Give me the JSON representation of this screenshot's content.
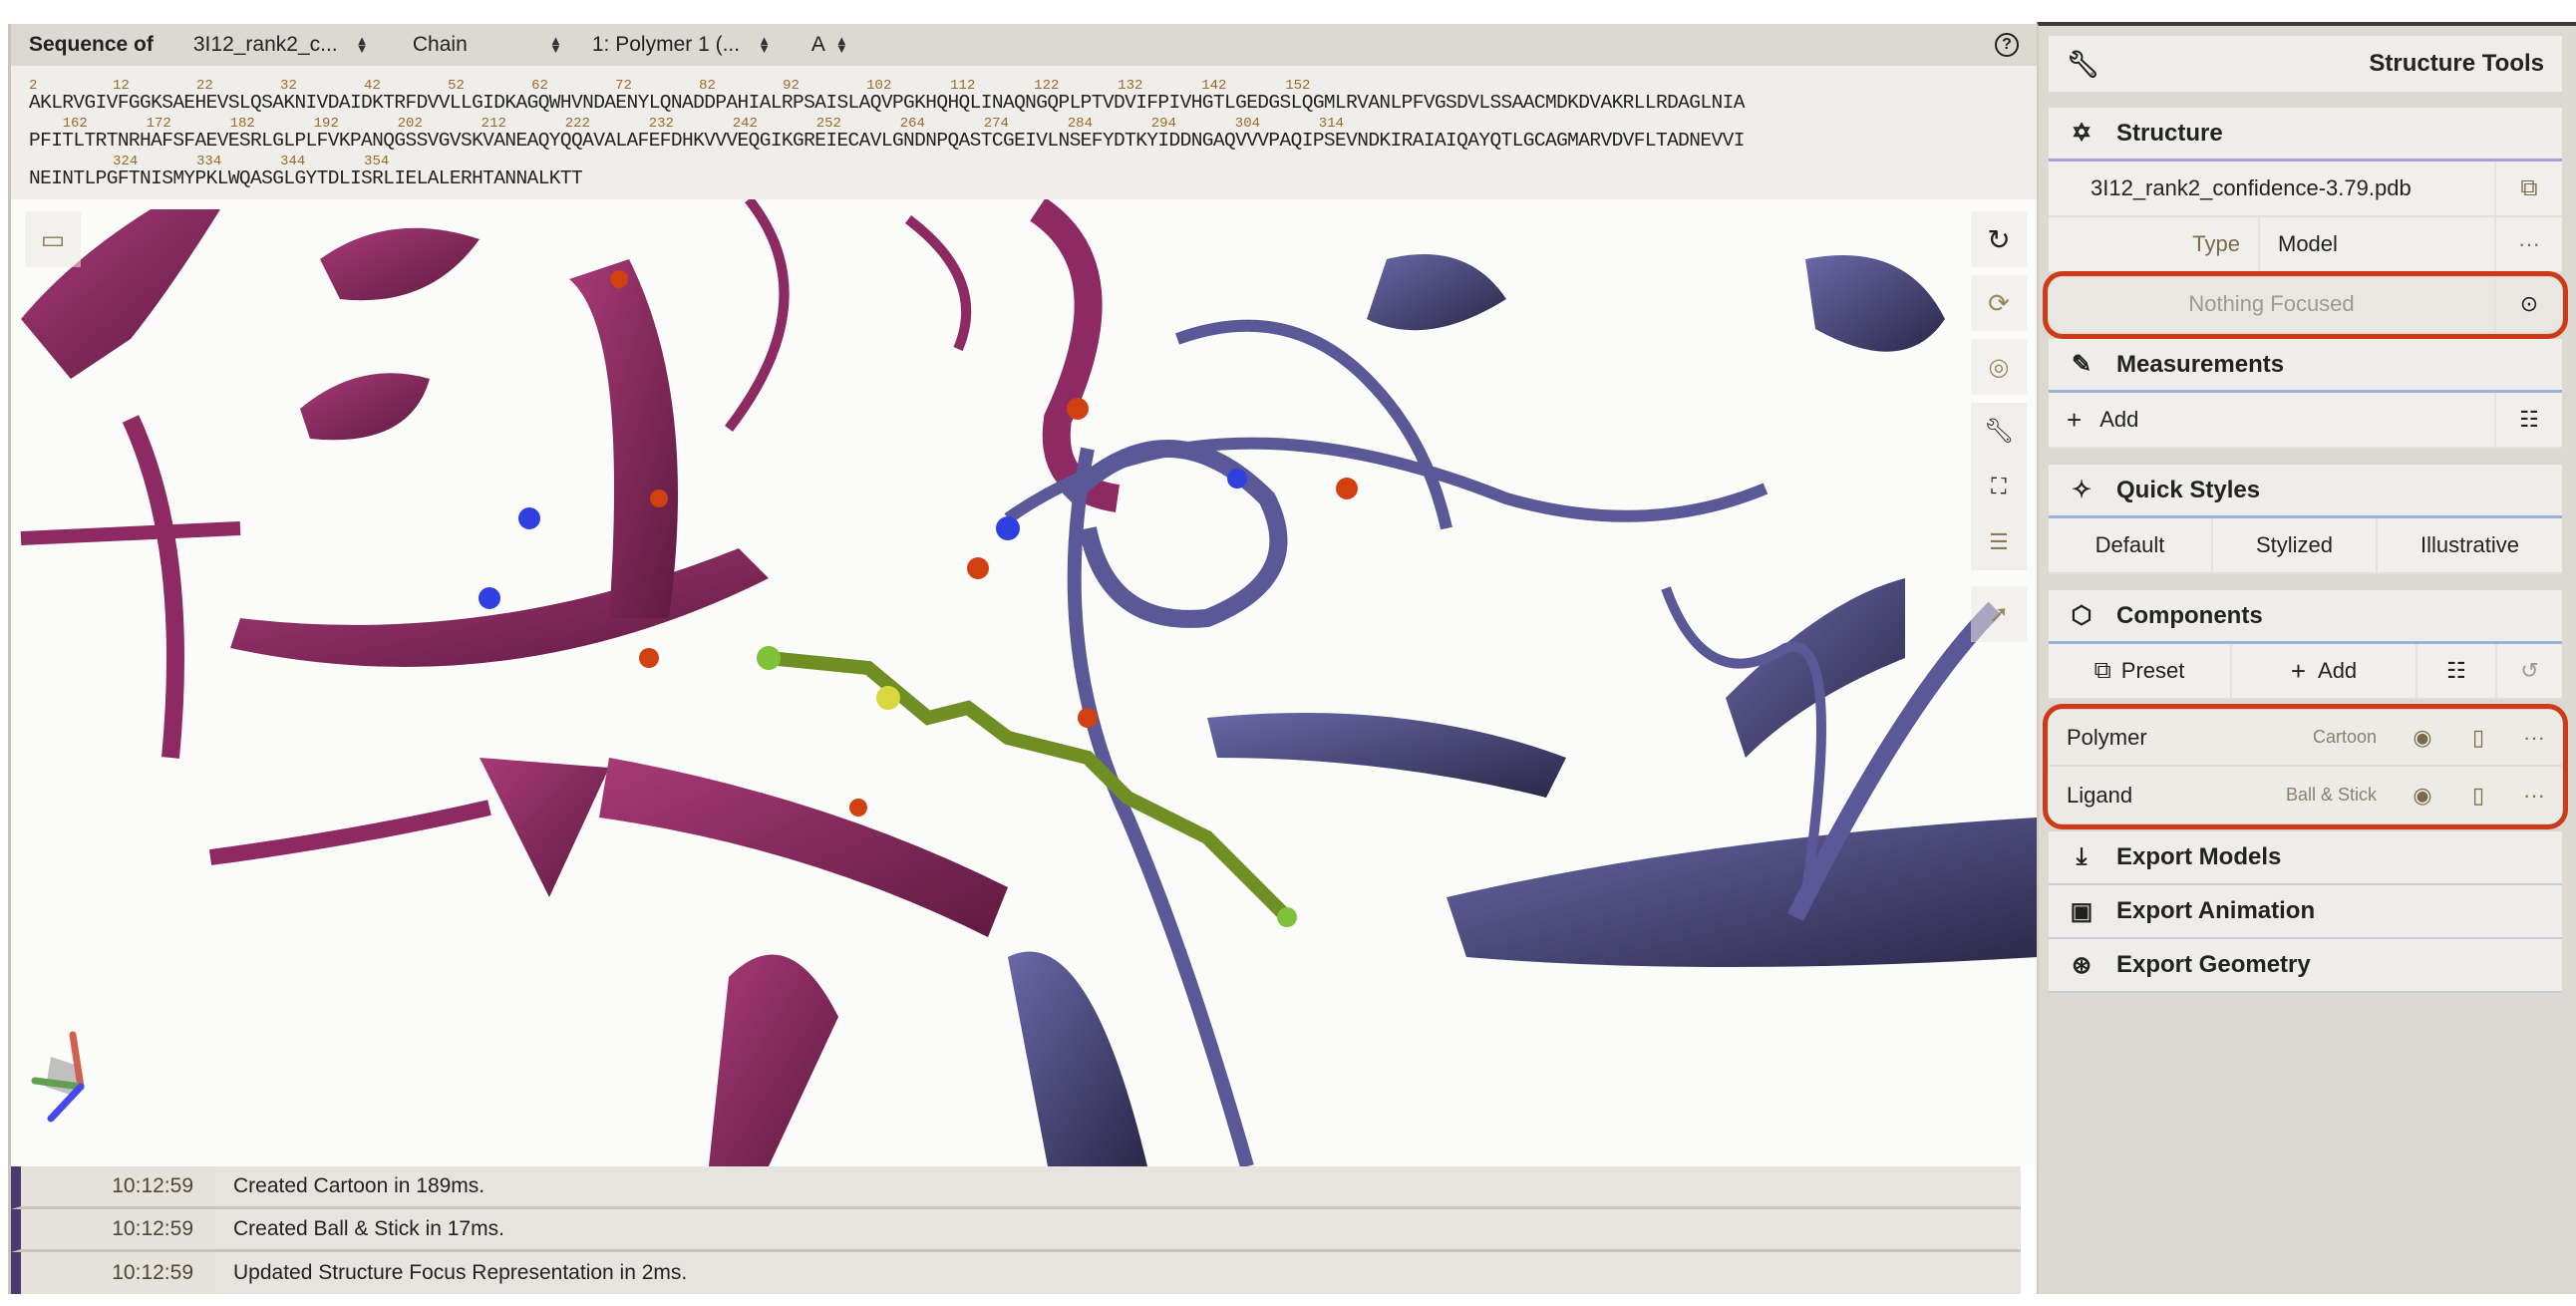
{
  "sequence_panel": {
    "title": "Sequence of",
    "selectors": [
      {
        "value": "3I12_rank2_c..."
      },
      {
        "value": "Chain"
      },
      {
        "value": "1: Polymer 1 (..."
      },
      {
        "value": "A"
      }
    ],
    "help_icon": "question-circle-icon",
    "lines": [
      {
        "numbers": "2         12        22        32        42        52        62        72        82        92        102       112       122       132       142       152",
        "residues": "AKLRVGIVFGGKSAEHEVSLQSAKNIVDAIDKTRFDVVLLGIDKAGQWHVNDAENYLQNADDPAHIALRPSAISLAQVPGKHQHQLINAQNGQPLPTVDVIFPIVHGTLGEDGSLQGMLRVANLPFVGSDVLSSAACMDKDVAKRLLRDAGLNIA"
      },
      {
        "numbers": "    162       172       182       192       202       212       222       232       242       252       264       274       284       294       304       314",
        "residues": "PFITLTRTNRHAFSFAEVESRLGLPLFVKPANQGSSVGVSKVANEAQYQQAVALAFEFDHKVVVEQGIKGREIECAVLGNDNPQASTCGEIVLNSEFYDTKYIDDNGAQVVVPAQIPSEVNDKIRAIAIQAYQTLGCAGMARVDVFLTADNEVVI"
      },
      {
        "numbers": "          324       334       344       354",
        "residues": "NEINTLPGFTNISMYPKLWQASGLGYTDLISRLIELALERHTANNALKTT"
      }
    ]
  },
  "viewport": {
    "left_button": "animation-icon",
    "toolbar": [
      {
        "name": "reset-camera",
        "icon": "reset-icon"
      },
      {
        "name": "spin",
        "icon": "spin-icon"
      },
      {
        "name": "screenshot",
        "icon": "camera-aperture-icon"
      },
      {
        "name": "tools",
        "icon": "wrench-icon"
      },
      {
        "name": "fullscreen",
        "icon": "fullscreen-icon"
      },
      {
        "name": "settings",
        "icon": "sliders-icon"
      },
      {
        "name": "selection-mode",
        "icon": "cursor-icon"
      }
    ],
    "colors": {
      "chain_a": "#8e2a63",
      "chain_b": "#5a5896",
      "ligand": "#6f8f24",
      "nitrogen": "#3040e0",
      "oxygen": "#d04010",
      "sulfur": "#d8d840"
    }
  },
  "log": [
    {
      "time": "10:12:59",
      "message": "Created Cartoon in 189ms."
    },
    {
      "time": "10:12:59",
      "message": "Created Ball & Stick in 17ms."
    },
    {
      "time": "10:12:59",
      "message": "Updated Structure Focus Representation in 2ms."
    }
  ],
  "sidebar": {
    "title": "Structure Tools",
    "structure": {
      "heading": "Structure",
      "file": "3I12_rank2_confidence-3.79.pdb",
      "type_label": "Type",
      "type_value": "Model",
      "focus_placeholder": "Nothing Focused"
    },
    "measurements": {
      "heading": "Measurements",
      "add_label": "Add"
    },
    "quick_styles": {
      "heading": "Quick Styles",
      "options": [
        "Default",
        "Stylized",
        "Illustrative"
      ]
    },
    "components": {
      "heading": "Components",
      "preset_label": "Preset",
      "add_label": "Add",
      "items": [
        {
          "name": "Polymer",
          "representation": "Cartoon"
        },
        {
          "name": "Ligand",
          "representation": "Ball & Stick"
        }
      ]
    },
    "exports": [
      {
        "label": "Export Models",
        "icon": "download-icon"
      },
      {
        "label": "Export Animation",
        "icon": "animation-icon"
      },
      {
        "label": "Export Geometry",
        "icon": "geometry-export-icon"
      }
    ],
    "highlight_color": "#cc3a17"
  }
}
